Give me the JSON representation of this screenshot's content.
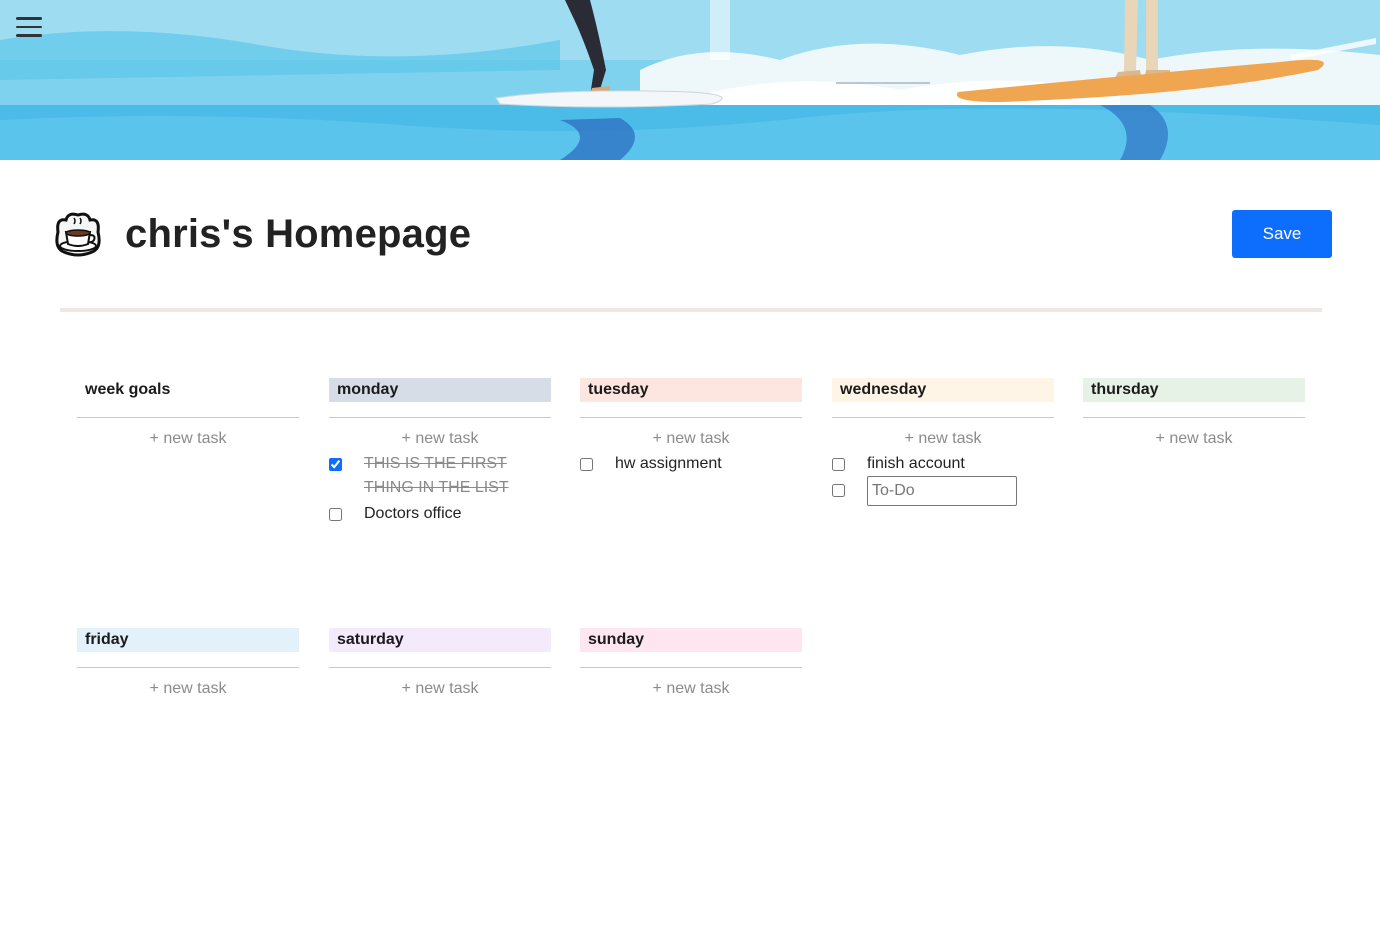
{
  "header": {
    "menu_icon": "hamburger-menu-icon",
    "title_icon": "coffee-cup-icon",
    "title": "chris's Homepage",
    "save_label": "Save"
  },
  "colors": {
    "accent": "#0d6efd",
    "divider": "#efe7e3",
    "monday": "#d6dde6",
    "tuesday": "#fde6e0",
    "wednesday": "#fff5e6",
    "thursday": "#e6f2e5",
    "friday": "#e3f1fa",
    "saturday": "#f3ebfc",
    "sunday": "#fde6ef"
  },
  "board": {
    "new_task_label": "+ new task",
    "columns": [
      {
        "name": "week goals",
        "tasks": []
      },
      {
        "name": "monday",
        "tasks": [
          {
            "text": "THIS IS THE FIRST THING IN THE LIST",
            "done": true
          },
          {
            "text": "Doctors office",
            "done": false
          }
        ]
      },
      {
        "name": "tuesday",
        "tasks": [
          {
            "text": "hw assignment",
            "done": false
          }
        ]
      },
      {
        "name": "wednesday",
        "tasks": [
          {
            "text": "finish account",
            "done": false
          }
        ],
        "new_input_placeholder": "To-Do"
      },
      {
        "name": "thursday",
        "tasks": []
      },
      {
        "name": "friday",
        "tasks": []
      },
      {
        "name": "saturday",
        "tasks": []
      },
      {
        "name": "sunday",
        "tasks": []
      }
    ]
  }
}
